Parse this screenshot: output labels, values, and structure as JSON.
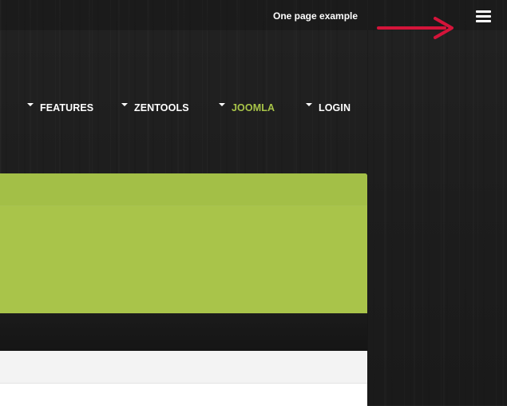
{
  "header": {
    "title": "One page example",
    "menu_icon": "hamburger-menu-icon",
    "annotation_icon": "red-arrow-icon",
    "annotation_color": "#d4143a"
  },
  "nav": {
    "items": [
      {
        "label": "FEATURES",
        "active": false
      },
      {
        "label": "ZENTOOLS",
        "active": false
      },
      {
        "label": "JOOMLA",
        "active": true
      },
      {
        "label": "LOGIN",
        "active": false
      }
    ],
    "active_color": "#a8c448"
  },
  "colors": {
    "accent": "#a9c44a",
    "background": "#1c1c1c",
    "light_bar": "#f3f3f3"
  }
}
